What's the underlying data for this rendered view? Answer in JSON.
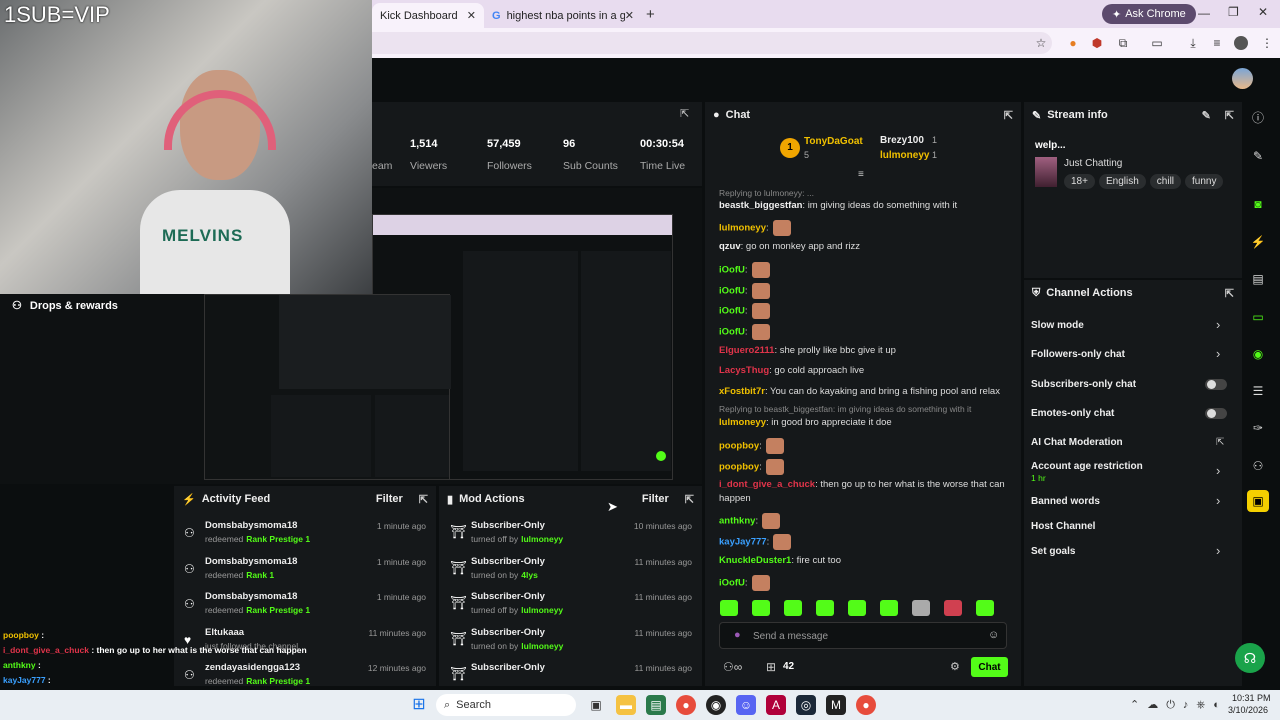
{
  "overlay": {
    "sub_text": "1SUB=VIP",
    "shirt_text": "MELVINS"
  },
  "browser": {
    "tabs": [
      {
        "label": "Kick Dashboard"
      },
      {
        "label": "highest nba points in a game b"
      }
    ],
    "ask": "Ask Chrome"
  },
  "stats": [
    {
      "value": "1,514",
      "label": "Viewers"
    },
    {
      "value": "57,459",
      "label": "Followers"
    },
    {
      "value": "96",
      "label": "Sub Counts"
    },
    {
      "value": "00:30:54",
      "label": "Time Live"
    }
  ],
  "stats_partial": "eam",
  "drops": {
    "title": "Drops & rewards"
  },
  "chat": {
    "title": "Chat",
    "top": {
      "rank": "1",
      "name1": "TonyDaGoat",
      "count1": "5",
      "name2": "Brezy100",
      "count2": "1",
      "name3": "lulmoneyy",
      "count3": "1"
    },
    "messages": [
      {
        "reply": "Replying to lulmoneyy: ..."
      },
      {
        "user": "beastk_biggestfan",
        "color": "#f0f0f0",
        "text": ": im giving ideas do something with it"
      },
      {
        "user": "lulmoneyy",
        "color": "#f0c000",
        "text": ":"
      },
      {
        "user": "qzuv",
        "color": "#f0f0f0",
        "text": ": go on monkey app and rizz"
      },
      {
        "user": "iOofU",
        "color": "#53fc18",
        "text": ":"
      },
      {
        "user": "iOofU",
        "color": "#53fc18",
        "text": ":"
      },
      {
        "user": "iOofU",
        "color": "#53fc18",
        "text": ":"
      },
      {
        "user": "iOofU",
        "color": "#53fc18",
        "text": ":"
      },
      {
        "user": "Elguero2111",
        "color": "#e0344a",
        "text": ": she prolly like bbc give it up"
      },
      {
        "user": "LacysThug",
        "color": "#e0344a",
        "text": ": go cold approach live"
      },
      {
        "user": "xFostbit7r",
        "color": "#f0c000",
        "text": ": You can do kayaking and bring a fishing pool and relax"
      },
      {
        "reply": "Replying to beastk_biggestfan: im giving ideas do something with it"
      },
      {
        "user": "lulmoneyy",
        "color": "#f0c000",
        "text": ": in good bro appreciate it doe"
      },
      {
        "user": "poopboy",
        "color": "#f0c000",
        "text": ":"
      },
      {
        "user": "poopboy",
        "color": "#f0c000",
        "text": ":"
      },
      {
        "user": "i_dont_give_a_chuck",
        "color": "#e0344a",
        "text": ": then go up to her what is the worse that can"
      },
      {
        "cont": "happen"
      },
      {
        "user": "anthkny",
        "color": "#53fc18",
        "text": ":"
      },
      {
        "user": "kayJay777",
        "color": "#3aa0ff",
        "text": ":"
      },
      {
        "user": "KnuckleDuster1",
        "color": "#53fc18",
        "text": ": fire cut too"
      },
      {
        "user": "iOofU",
        "color": "#53fc18",
        "text": ":"
      }
    ],
    "placeholder": "Send a message",
    "viewers": "42",
    "send": "Chat"
  },
  "stream_info": {
    "title": "Stream info",
    "stream_title": "welp...",
    "category": "Just Chatting",
    "tags": [
      "18+",
      "English",
      "chill",
      "funny"
    ]
  },
  "channel_actions": {
    "title": "Channel Actions",
    "items": [
      {
        "label": "Slow mode",
        "kind": "chevron"
      },
      {
        "label": "Followers-only chat",
        "kind": "chevron"
      },
      {
        "label": "Subscribers-only chat",
        "kind": "toggle"
      },
      {
        "label": "Emotes-only chat",
        "kind": "toggle"
      },
      {
        "label": "AI Chat Moderation",
        "kind": "external"
      },
      {
        "label": "Account age restriction",
        "kind": "chevron",
        "sub": "1 hr"
      },
      {
        "label": "Banned words",
        "kind": "chevron"
      },
      {
        "label": "Host Channel",
        "kind": "none"
      },
      {
        "label": "Set goals",
        "kind": "chevron"
      }
    ]
  },
  "activity_feed": {
    "title": "Activity Feed",
    "filter": "Filter",
    "items": [
      {
        "user": "Domsbabysmoma18",
        "action": "redeemed",
        "target": "Rank Prestige 1",
        "time": "1 minute ago"
      },
      {
        "user": "Domsbabysmoma18",
        "action": "redeemed",
        "target": "Rank 1",
        "time": "1 minute ago"
      },
      {
        "user": "Domsbabysmoma18",
        "action": "redeemed",
        "target": "Rank Prestige 1",
        "time": "1 minute ago"
      },
      {
        "user": "Eltukaaa",
        "action": "just followed the channel",
        "target": "",
        "time": "11 minutes ago"
      },
      {
        "user": "zendayasidengga123",
        "action": "redeemed",
        "target": "Rank Prestige 1",
        "time": "12 minutes ago"
      }
    ]
  },
  "mod_actions": {
    "title": "Mod Actions",
    "filter": "Filter",
    "items": [
      {
        "action": "Subscriber-Only",
        "detail": "turned off by",
        "by": "lulmoneyy",
        "time": "10 minutes ago"
      },
      {
        "action": "Subscriber-Only",
        "detail": "turned on by",
        "by": "4lys",
        "time": "11 minutes ago"
      },
      {
        "action": "Subscriber-Only",
        "detail": "turned off by",
        "by": "lulmoneyy",
        "time": "11 minutes ago"
      },
      {
        "action": "Subscriber-Only",
        "detail": "turned on by",
        "by": "lulmoneyy",
        "time": "11 minutes ago"
      },
      {
        "action": "Subscriber-Only",
        "detail": "",
        "by": "",
        "time": "11 minutes ago"
      }
    ]
  },
  "overlay_chat": [
    {
      "user": "poopboy",
      "color": "#f0c000",
      "text": " :"
    },
    {
      "user": "i_dont_give_a_chuck",
      "color": "#e0344a",
      "text": " : then go up to her what is the worse that can happen"
    },
    {
      "user": "anthkny",
      "color": "#53fc18",
      "text": " :"
    },
    {
      "user": "kayJay777",
      "color": "#3aa0ff",
      "text": " :"
    },
    {
      "user": "KnuckleDuster1",
      "color": "#53fc18",
      "text": " : fire cut too"
    },
    {
      "user": "iOofU",
      "color": "#53fc18",
      "text": " :"
    }
  ],
  "taskbar": {
    "search": "Search",
    "time": "10:31 PM",
    "date": "3/10/2026"
  }
}
